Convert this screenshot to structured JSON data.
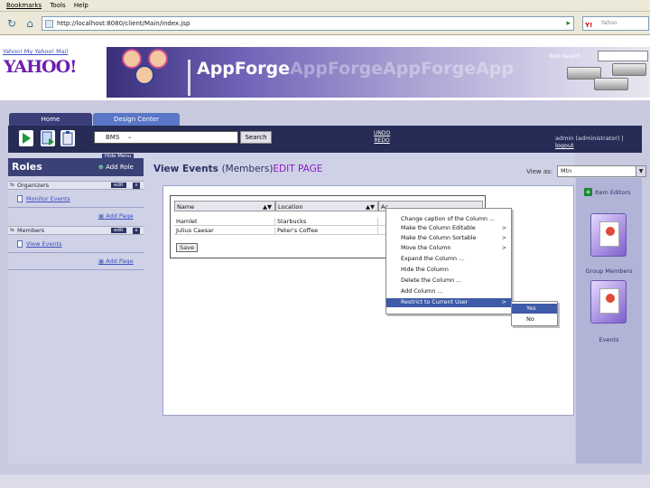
{
  "browser": {
    "menu": [
      "Bookmarks",
      "Tools",
      "Help"
    ],
    "url": "http://localhost:8080/client/Main/index.jsp",
    "search_engine": "Yahoo"
  },
  "header": {
    "links": "Yahoo! My Yahoo! Mail",
    "logo": "YAHOO!",
    "brand": "AppForge",
    "brand_ghost": "AppForgeAppForgeApp",
    "web_search_label": "Web Search"
  },
  "tabs": {
    "home": "Home",
    "design": "Design Center"
  },
  "toolbar": {
    "app_select": "BMS",
    "search_button": "Search",
    "undo": "UNDO",
    "redo": "REDO",
    "user_text": "admin (administrator) |",
    "logout": "logout"
  },
  "sidebar": {
    "hide_menu": "Hide Menu",
    "title": "Roles",
    "add_role": "Add Role",
    "sections": [
      {
        "name": "Organizers",
        "edit": "edit",
        "close": "x",
        "link": "Monitor Events",
        "add_page": "Add Page"
      },
      {
        "name": "Members",
        "edit": "edit",
        "close": "x",
        "link": "View Events",
        "add_page": "Add Page"
      }
    ]
  },
  "main": {
    "title": "View Events",
    "title_role": "(Members)",
    "title_mode": "EDIT PAGE",
    "view_as_label": "View as:",
    "view_as_value": "Mtn"
  },
  "grid": {
    "columns": [
      "Name",
      "Location",
      "Ac"
    ],
    "rows": [
      [
        "Hamlet",
        "Starbucks",
        ""
      ],
      [
        "Julius Caesar",
        "Peter's Coffee",
        ""
      ]
    ],
    "save": "Save"
  },
  "context_menu": {
    "items": [
      {
        "label": "Change caption of the Column ...",
        "sub": false
      },
      {
        "label": "Make the Column Editable",
        "sub": true
      },
      {
        "label": "Make the Column Sortable",
        "sub": true
      },
      {
        "label": "Move the Column",
        "sub": true
      },
      {
        "label": "Expand the Column ...",
        "sub": false
      },
      {
        "label": "Hide the Column",
        "sub": false
      },
      {
        "label": "Delete the Column ...",
        "sub": false
      },
      {
        "label": "Add Column ...",
        "sub": false
      },
      {
        "label": "Restrict to Current User",
        "sub": true
      }
    ],
    "arrow": ">",
    "submenu": [
      "Yes",
      "No"
    ]
  },
  "right_panel": {
    "item_editors": "Item Editors",
    "folders": [
      "Group Members",
      "Events"
    ]
  },
  "colors": {
    "accent": "#3e5aa8",
    "toolbar": "#262c55",
    "title": "#2b3266",
    "edit_page": "#8a1dc5"
  }
}
